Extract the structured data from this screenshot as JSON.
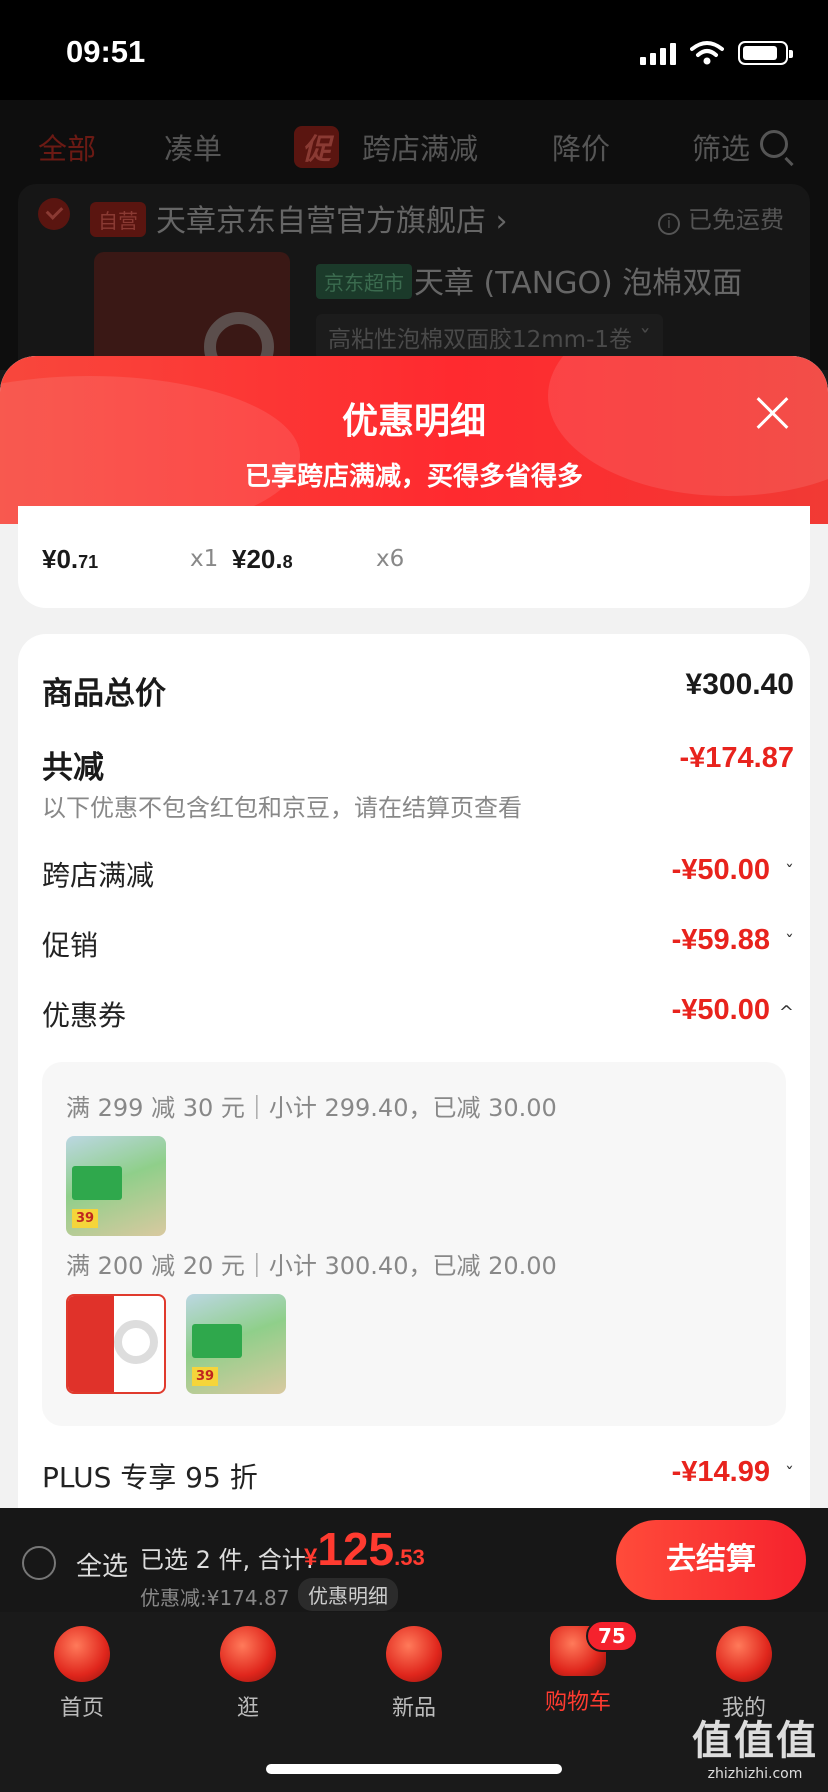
{
  "status_bar": {
    "time": "09:51"
  },
  "filters": {
    "all": "全部",
    "combine": "凑单",
    "promo_badge": "促",
    "cross_store": "跨店满减",
    "price_drop": "降价",
    "filter": "筛选"
  },
  "store": {
    "self_badge": "自营",
    "name": "天章京东自营官方旗舰店 ›",
    "free_shipping": "已免运费",
    "product": {
      "channel_badge": "京东超市",
      "title": "天章 (TANGO) 泡棉双面",
      "spec": "高粘性泡棉双面胶12mm-1卷 ˇ"
    }
  },
  "sheet": {
    "title": "优惠明细",
    "subtitle": "已享跨店满减，买得多省得多",
    "items": [
      {
        "price_int": "¥0.",
        "price_dec": "71",
        "qty": "x1"
      },
      {
        "price_int": "¥20.",
        "price_dec": "8",
        "qty": "x6"
      }
    ],
    "summary": {
      "total_label": "商品总价",
      "total_value": "¥300.40",
      "reduce_label": "共减",
      "reduce_value": "-¥174.87",
      "note": "以下优惠不包含红包和京豆，请在结算页查看",
      "lines": [
        {
          "label": "跨店满减",
          "value": "-¥50.00",
          "chevron": "ˇ"
        },
        {
          "label": "促销",
          "value": "-¥59.88",
          "chevron": "ˇ"
        },
        {
          "label": "优惠券",
          "value": "-¥50.00",
          "chevron": "^"
        }
      ],
      "coupons": [
        "满 299 减 30 元｜小计 299.40，已减 30.00",
        "满 200 减 20 元｜小计 300.40，已减 20.00"
      ],
      "thumb_price_tag": "39",
      "plus": {
        "label": "PLUS 专享 95 折",
        "value": "-¥14.99",
        "chevron": "ˇ"
      }
    }
  },
  "checkout": {
    "select_all": "全选",
    "selected_info": "已选 2 件, 合计:",
    "total_yen": "¥",
    "total_int": "125",
    "total_dec": ".53",
    "discount_line": "优惠减:¥174.87",
    "discount_detail": "优惠明细",
    "go": "去结算"
  },
  "tabs": [
    {
      "label": "首页",
      "icon": "home-icon"
    },
    {
      "label": "逛",
      "icon": "browse-icon"
    },
    {
      "label": "新品",
      "icon": "new-icon"
    },
    {
      "label": "购物车",
      "icon": "cart-icon",
      "badge": "75"
    },
    {
      "label": "我的",
      "icon": "profile-icon"
    }
  ],
  "watermark": {
    "main": "值值值",
    "url": "zhizhizhi.com"
  }
}
